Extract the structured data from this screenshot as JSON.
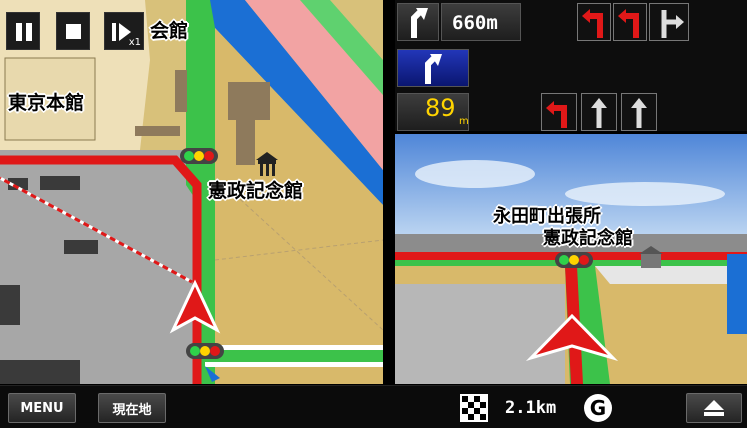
{
  "map": {
    "labels": [
      "会館",
      "東京本館",
      "憲政記念館"
    ],
    "controls": {
      "speed_tag": "x1"
    }
  },
  "guidance": {
    "next_distance": "660m",
    "remaining_meters": "89",
    "meters_unit": "m"
  },
  "view3d": {
    "labels": [
      "永田町出張所",
      "憲政記念館"
    ]
  },
  "bottombar": {
    "menu_label": "MENU",
    "location_label": "現在地",
    "destination_distance": "2.1km",
    "route_mode_label": "G"
  },
  "colors": {
    "route_red": "#e01818",
    "road_green": "#3cc24a",
    "map_tan": "#d8c17a",
    "map_gray": "#a0a0a0",
    "guide_yellow": "#ffd400"
  }
}
